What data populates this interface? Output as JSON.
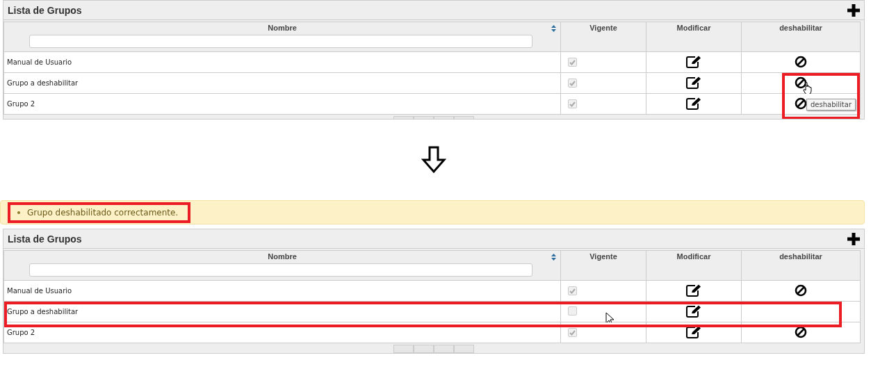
{
  "panels": [
    {
      "title": "Lista de Grupos",
      "columns": [
        "Nombre",
        "Vigente",
        "Modificar",
        "deshabilitar"
      ],
      "rows": [
        {
          "name": "Manual de Usuario",
          "checked": true,
          "can_disable": true,
          "highlighted": false,
          "disable_highlighted": false
        },
        {
          "name": "Grupo a deshabilitar",
          "checked": true,
          "can_disable": true,
          "highlighted": false,
          "disable_highlighted": true,
          "hand_cursor": true,
          "tooltip": "deshabilitar"
        },
        {
          "name": "Grupo 2",
          "checked": true,
          "can_disable": true,
          "highlighted": false,
          "disable_highlighted": true
        }
      ]
    },
    {
      "message": {
        "text": "Grupo deshabilitado correctamente.",
        "highlighted": true
      },
      "title": "Lista de Grupos",
      "columns": [
        "Nombre",
        "Vigente",
        "Modificar",
        "deshabilitar"
      ],
      "rows": [
        {
          "name": "Manual de Usuario",
          "checked": true,
          "can_disable": true,
          "highlighted": false,
          "disable_highlighted": false
        },
        {
          "name": "Grupo a deshabilitar",
          "checked": false,
          "can_disable": false,
          "highlighted": true,
          "disable_highlighted": false,
          "arrow_cursor": true
        },
        {
          "name": "Grupo 2",
          "checked": true,
          "can_disable": true,
          "highlighted": false,
          "disable_highlighted": false
        }
      ]
    }
  ]
}
